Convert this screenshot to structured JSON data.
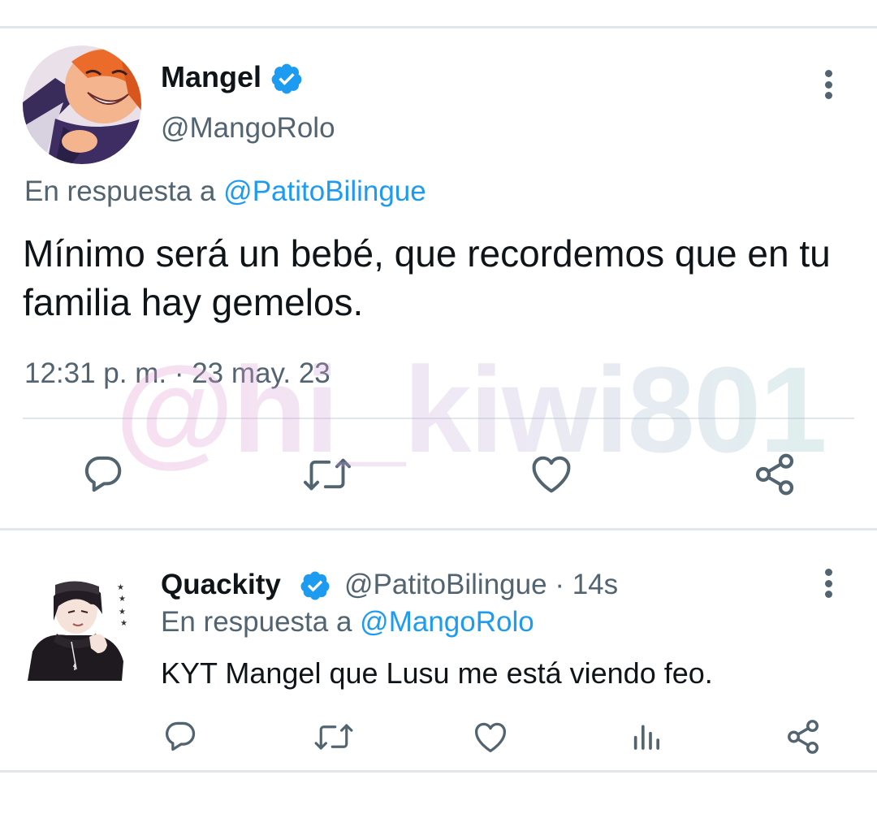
{
  "main_tweet": {
    "author_name": "Mangel",
    "author_handle": "@MangoRolo",
    "reply_prefix": "En respuesta a",
    "reply_to": "@PatitoBilingue",
    "text": "Mínimo será un bebé, que recordemos que en tu familia hay gemelos.",
    "timestamp": "12:31 p. m. · 23 may. 23",
    "actions": [
      "reply-icon",
      "retweet-icon",
      "like-icon",
      "share-icon"
    ]
  },
  "reply_tweet": {
    "author_name": "Quackity",
    "author_handle": "@PatitoBilingue",
    "time_ago": "14s",
    "reply_prefix": "En respuesta a",
    "reply_to": "@MangoRolo",
    "text": "KYT Mangel que Lusu me está viendo feo.",
    "actions": [
      "reply-icon",
      "retweet-icon",
      "like-icon",
      "analytics-icon",
      "share-icon"
    ]
  },
  "watermark": "@hi_kiwi801",
  "colors": {
    "text": "#0f1419",
    "secondary": "#536471",
    "accent": "#1d9bf0",
    "divider": "#e1e6ea"
  }
}
